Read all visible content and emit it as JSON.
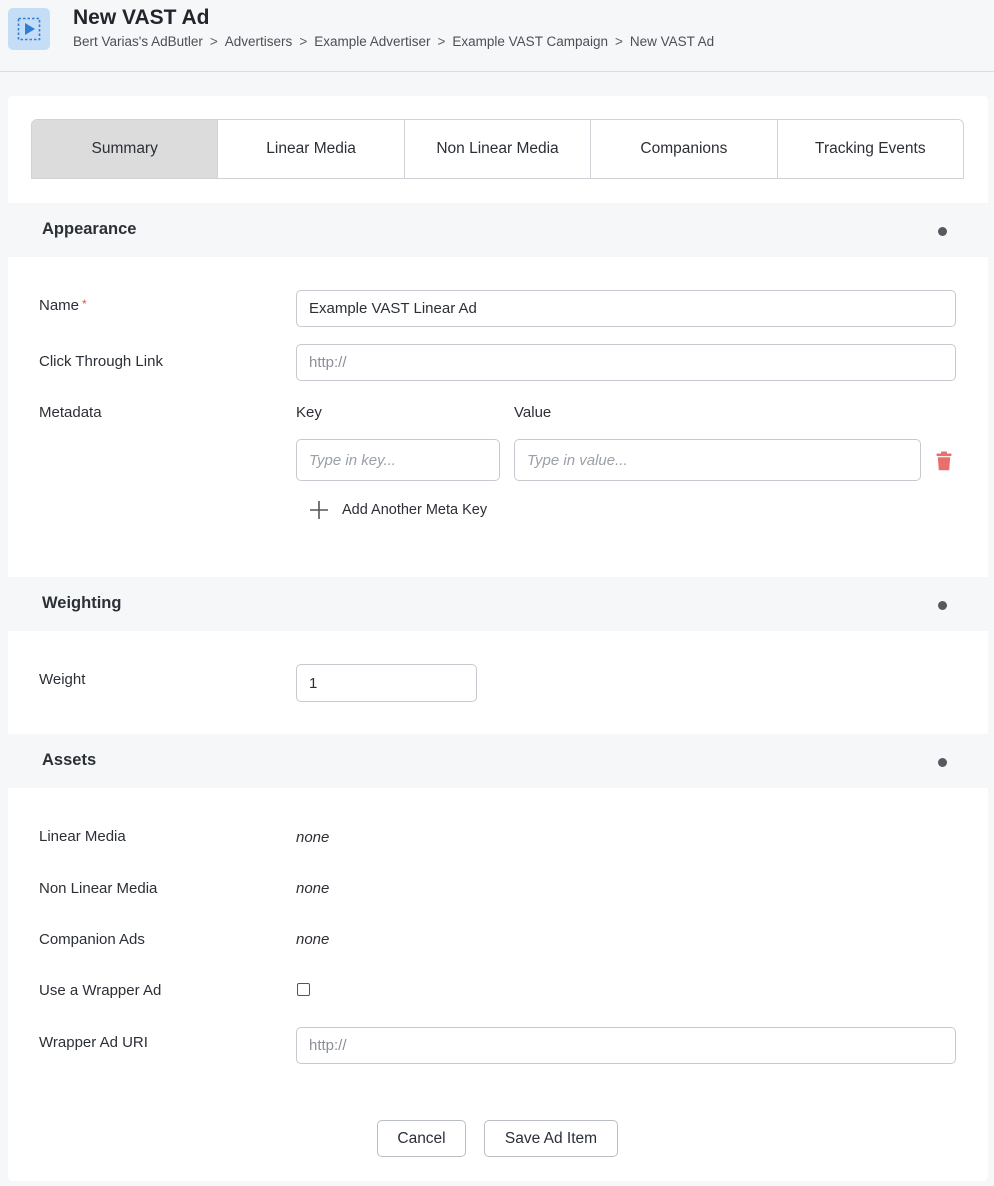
{
  "header": {
    "title": "New VAST Ad",
    "icon": "video-ad-icon",
    "breadcrumb": [
      "Bert Varias's AdButler",
      "Advertisers",
      "Example Advertiser",
      "Example VAST Campaign",
      "New VAST Ad"
    ],
    "separator": ">"
  },
  "tabs": [
    "Summary",
    "Linear Media",
    "Non Linear Media",
    "Companions",
    "Tracking Events"
  ],
  "active_tab": "Summary",
  "appearance": {
    "title": "Appearance",
    "name_label": "Name",
    "required_mark": "*",
    "name_value": "Example VAST Linear Ad",
    "click_label": "Click Through Link",
    "click_placeholder": "http://",
    "metadata_label": "Metadata",
    "key_label": "Key",
    "value_label": "Value",
    "key_placeholder": "Type in key...",
    "value_placeholder": "Type in value...",
    "add_meta_label": "Add Another Meta Key"
  },
  "weighting": {
    "title": "Weighting",
    "weight_label": "Weight",
    "weight_value": "1"
  },
  "assets": {
    "title": "Assets",
    "linear_label": "Linear Media",
    "linear_value": "none",
    "nonlinear_label": "Non Linear Media",
    "nonlinear_value": "none",
    "companion_label": "Companion Ads",
    "companion_value": "none",
    "wrapper_label": "Use a Wrapper Ad",
    "wrapper_checked": false,
    "wrapper_uri_label": "Wrapper Ad URI",
    "wrapper_uri_placeholder": "http://"
  },
  "actions": {
    "cancel": "Cancel",
    "save": "Save Ad Item"
  },
  "colors": {
    "accent_icon_bg": "#c5ddf6",
    "accent_icon": "#2f7fd6",
    "required": "#d9534f",
    "trash": "#e8706c",
    "active_tab": "#dcdcdc"
  }
}
